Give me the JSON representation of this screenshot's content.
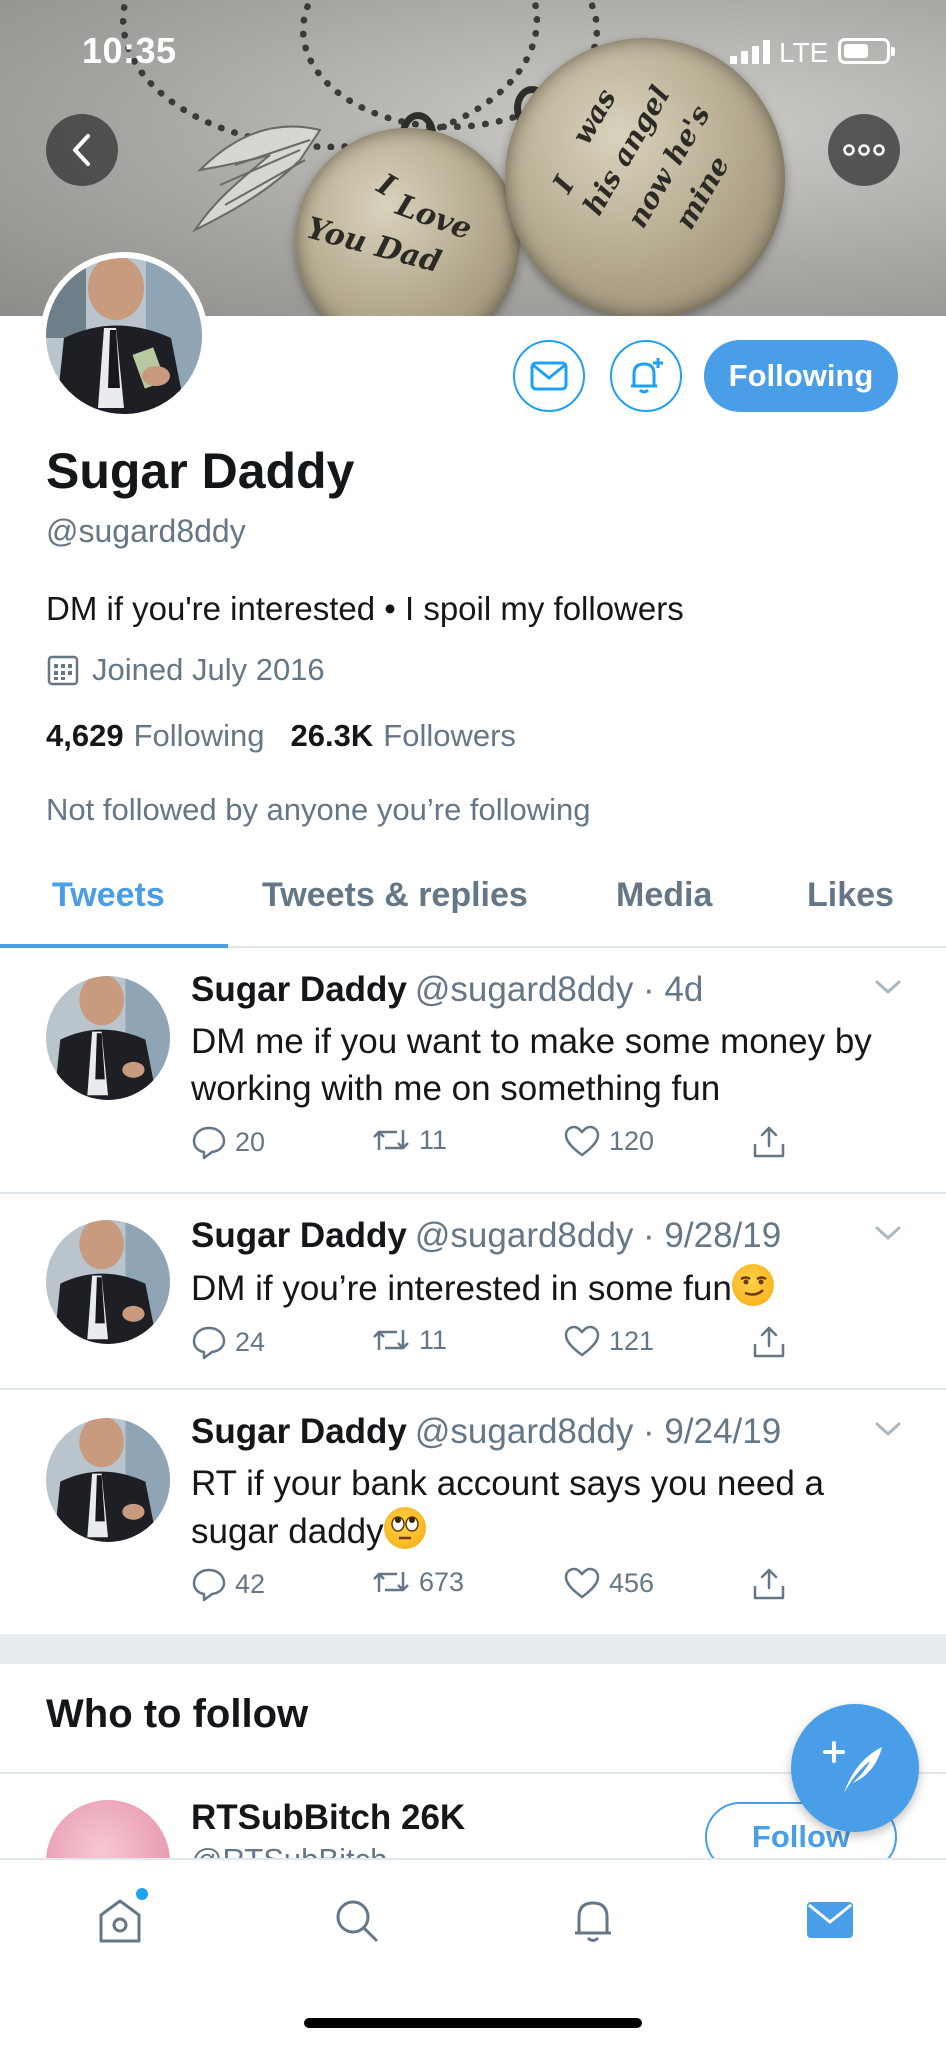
{
  "status_bar": {
    "time": "10:35",
    "network": "LTE"
  },
  "banner": {
    "pendant_left_lines": [
      "I",
      "Love",
      "You Dad"
    ],
    "pendant_right_lines": [
      "I",
      "was",
      "his angel",
      "now he's",
      "mine"
    ]
  },
  "profile": {
    "name": "Sugar Daddy",
    "handle": "@sugard8ddy",
    "bio": "DM if you're interested • I spoil my followers",
    "joined": "Joined July 2016",
    "following_count": "4,629",
    "following_label": "Following",
    "followers_count": "26.3K",
    "followers_label": "Followers",
    "not_followed_text": "Not followed by anyone you’re following",
    "following_button": "Following"
  },
  "tabs": [
    {
      "label": "Tweets",
      "active": true
    },
    {
      "label": "Tweets & replies",
      "active": false
    },
    {
      "label": "Media",
      "active": false
    },
    {
      "label": "Likes",
      "active": false
    }
  ],
  "tweets": [
    {
      "name": "Sugar Daddy",
      "meta": "@sugard8ddy · 4d",
      "text": "DM me if you want to make some money by working with me on something fun",
      "emoji": "",
      "replies": "20",
      "retweets": "11",
      "likes": "120"
    },
    {
      "name": "Sugar Daddy",
      "meta": "@sugard8ddy · 9/28/19",
      "text": "DM if you’re interested in some fun",
      "emoji": "smirk",
      "replies": "24",
      "retweets": "11",
      "likes": "121"
    },
    {
      "name": "Sugar Daddy",
      "meta": "@sugard8ddy · 9/24/19",
      "text": "RT if your bank account says you need a sugar daddy",
      "emoji": "eye-roll",
      "replies": "42",
      "retweets": "673",
      "likes": "456"
    }
  ],
  "who_to_follow": {
    "title": "Who to follow",
    "name": "RTSubBitch 26K",
    "handle": "@RTSubBitch",
    "button": "Follow"
  },
  "colors": {
    "accent": "#4a9de7",
    "secondary_text": "#657786",
    "primary_text": "#14171a",
    "divider": "#e1e8ed"
  }
}
